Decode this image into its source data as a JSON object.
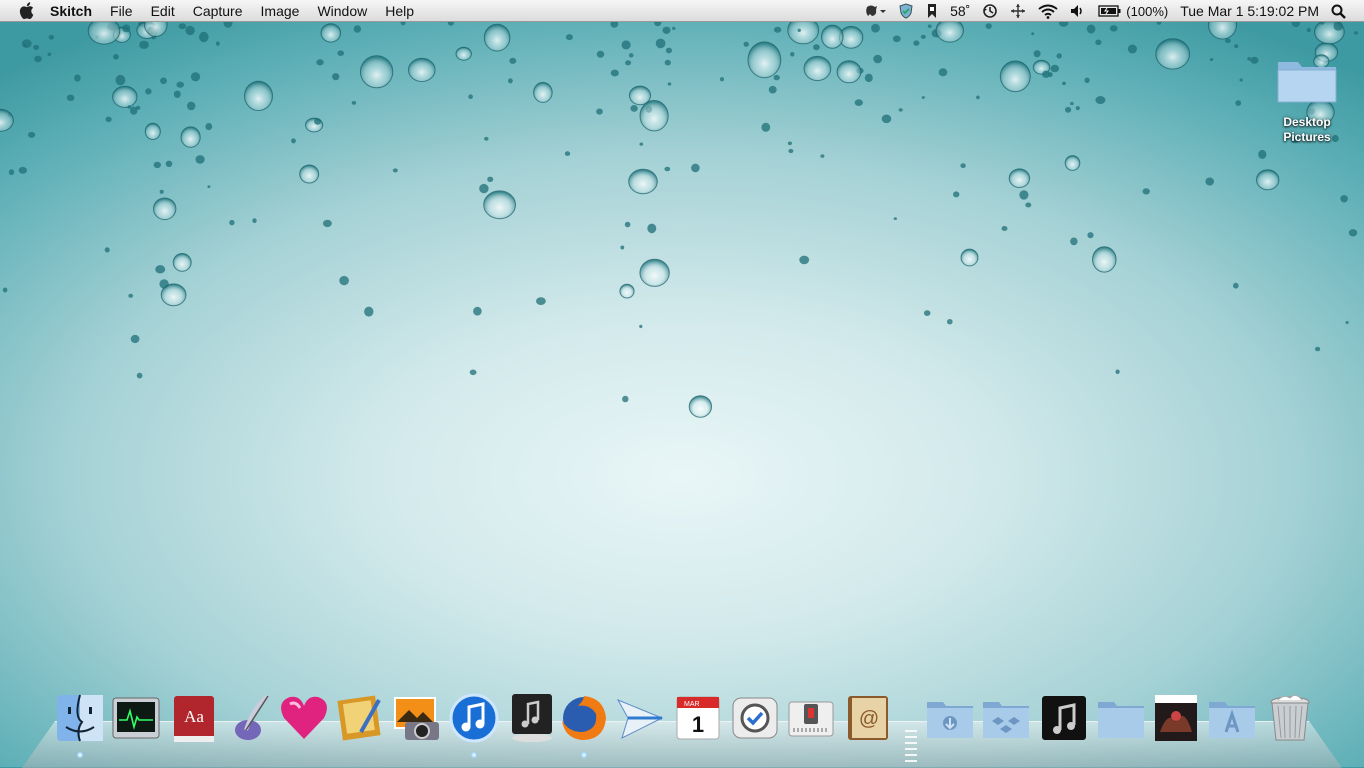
{
  "menubar": {
    "app_name": "Skitch",
    "items": [
      "File",
      "Edit",
      "Capture",
      "Image",
      "Window",
      "Help"
    ],
    "status": {
      "temperature": "58˚",
      "battery": "(100%)",
      "datetime": "Tue Mar 1  5:19:02 PM"
    }
  },
  "desktop": {
    "icons": [
      {
        "label_line1": "Desktop",
        "label_line2": "Pictures",
        "icon": "folder-icon"
      }
    ]
  },
  "dock": {
    "items": [
      {
        "name": "Finder",
        "icon": "finder-icon",
        "running": true
      },
      {
        "name": "Activity Monitor",
        "icon": "activity-monitor-icon",
        "running": false
      },
      {
        "name": "Dictionary",
        "icon": "dictionary-icon",
        "running": false
      },
      {
        "name": "Script Editor",
        "icon": "quill-pen-icon",
        "running": false
      },
      {
        "name": "Heart app",
        "icon": "heart-icon",
        "running": false
      },
      {
        "name": "Preview",
        "icon": "preview-icon",
        "running": false
      },
      {
        "name": "iPhoto",
        "icon": "photo-camera-icon",
        "running": false
      },
      {
        "name": "iTunes",
        "icon": "itunes-icon",
        "running": true
      },
      {
        "name": "Music Player",
        "icon": "music-note-dock-icon",
        "running": false
      },
      {
        "name": "Firefox",
        "icon": "firefox-icon",
        "running": true
      },
      {
        "name": "Sparrow",
        "icon": "paper-plane-icon",
        "running": false
      },
      {
        "name": "iCal",
        "icon": "calendar-icon",
        "calendar_month": "MAR",
        "calendar_day": "1",
        "running": false
      },
      {
        "name": "Things",
        "icon": "checkmark-icon",
        "running": false
      },
      {
        "name": "Switch app",
        "icon": "switch-icon",
        "running": false
      },
      {
        "name": "Address Book",
        "icon": "address-book-icon",
        "running": false
      },
      {
        "name": "Documents folder",
        "icon": "downloads-folder-icon",
        "running": false
      },
      {
        "name": "Dropbox folder",
        "icon": "dropbox-folder-icon",
        "running": false
      },
      {
        "name": "Music folder",
        "icon": "music-folder-icon",
        "running": false
      },
      {
        "name": "Folder",
        "icon": "folder-icon",
        "running": false
      },
      {
        "name": "Game",
        "icon": "game-cover-icon",
        "running": false
      },
      {
        "name": "Applications folder",
        "icon": "applications-folder-icon",
        "running": false
      },
      {
        "name": "Trash",
        "icon": "trash-icon",
        "running": false
      }
    ]
  },
  "colors": {
    "desktop_center": "#e9f6f7",
    "desktop_edge": "#3e9aa2",
    "folder_blue": "#9cc4e4"
  }
}
